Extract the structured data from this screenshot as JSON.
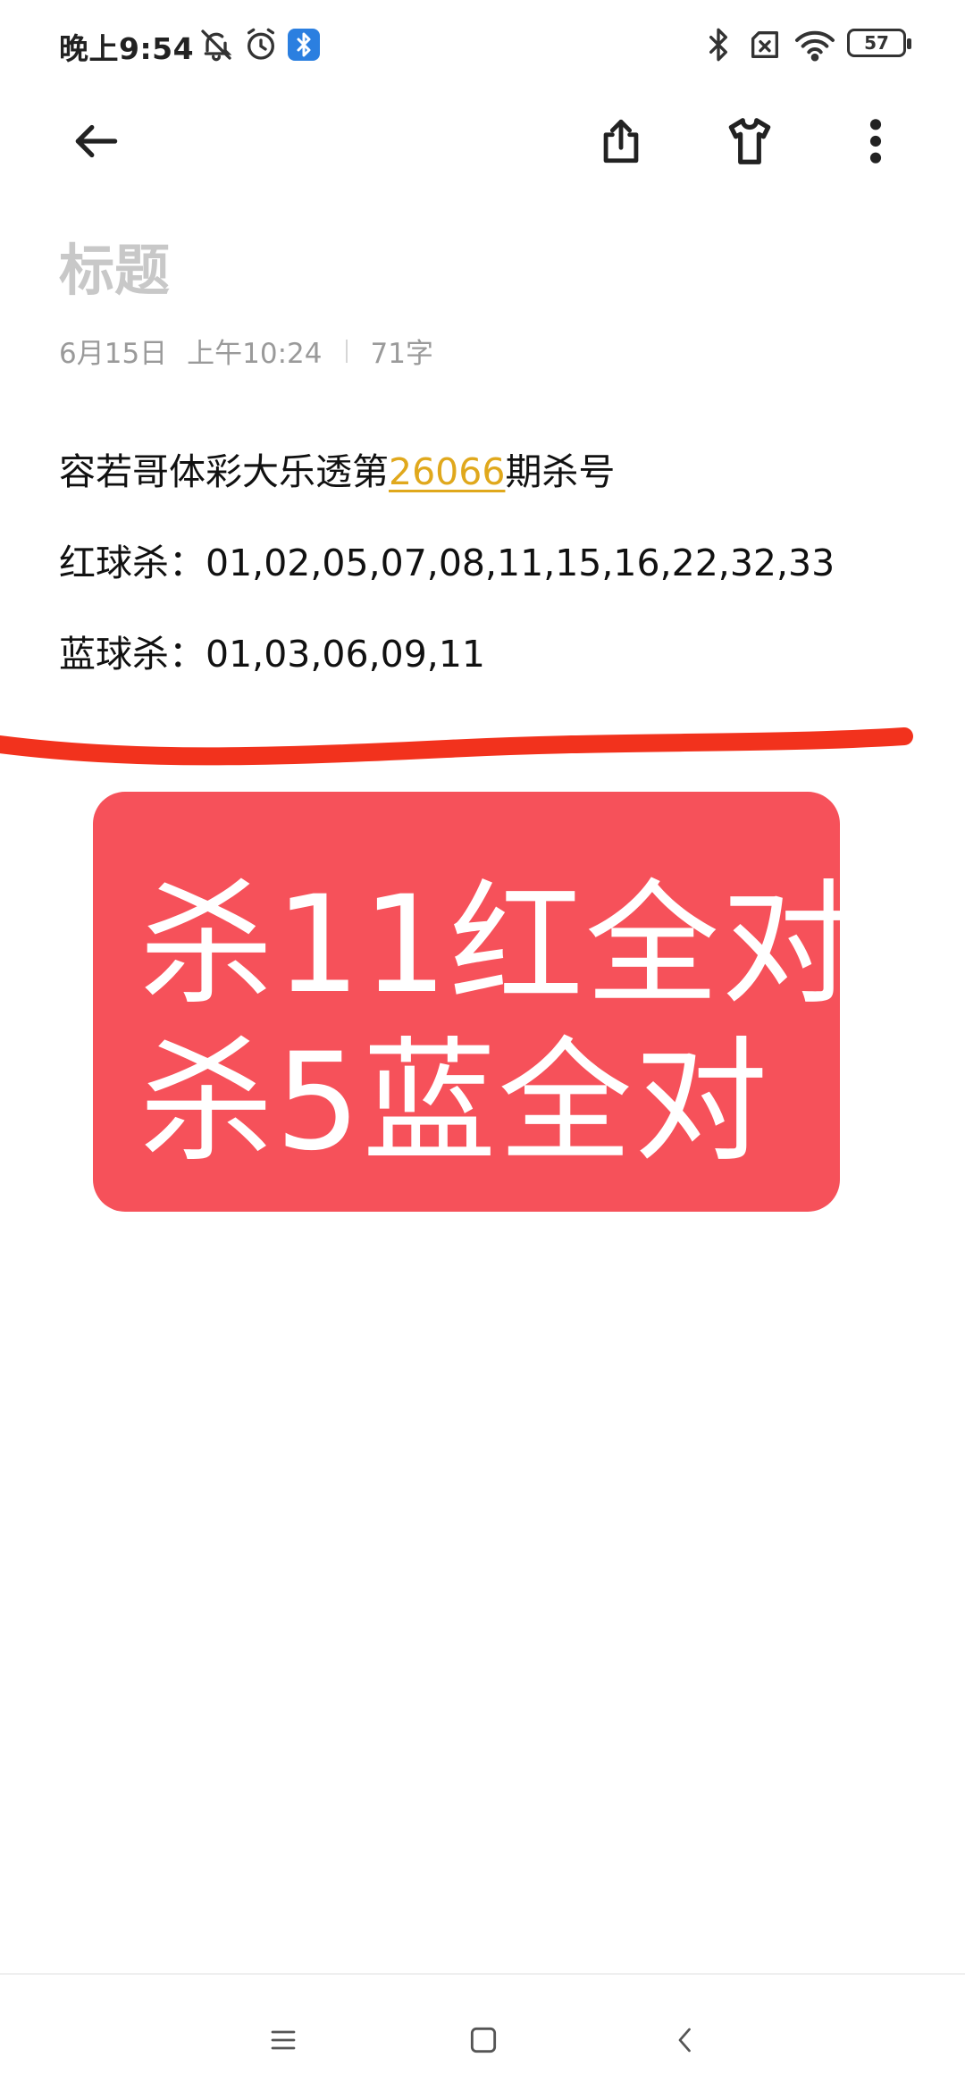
{
  "status_bar": {
    "time": "晚上9:54",
    "battery": "57",
    "icons": [
      "bell-off-icon",
      "alarm-icon",
      "bluetooth-app-icon",
      "bluetooth-icon",
      "no-sim-icon",
      "wifi-icon",
      "battery-icon"
    ]
  },
  "toolbar": {
    "icons": [
      "back-arrow-icon",
      "share-icon",
      "theme-shirt-icon",
      "more-vertical-icon"
    ]
  },
  "note": {
    "title_placeholder": "标题",
    "date": "6月15日",
    "time": "上午10:24",
    "word_count": "71字",
    "line1_prefix": "容若哥体彩大乐透第",
    "line1_number": "26066",
    "line1_suffix": "期杀号",
    "line2": "红球杀：01,02,05,07,08,11,15,16,22,32,33",
    "line3": "蓝球杀：01,03,06,09,11"
  },
  "image": {
    "line1": "杀11红全对",
    "line2": "杀5蓝全对",
    "card_color": "#f6515a",
    "stroke_color": "#f2321d"
  },
  "colors": {
    "accent_link": "#e0a81c",
    "title_placeholder": "#c8c8c8",
    "meta_text": "#9a9a9a"
  },
  "nav_bar": {
    "icons": [
      "menu-icon",
      "home-square-icon",
      "back-chevron-icon"
    ]
  }
}
